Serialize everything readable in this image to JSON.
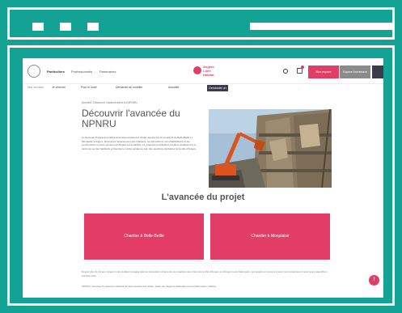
{
  "nav": {
    "links": [
      "Particuliers",
      "Professionnels",
      "Partenaires"
    ],
    "brand_line1": "Angers",
    "brand_line2": "Loire",
    "brand_line3": "Habitat",
    "btn_primary": "Mon espace",
    "btn_secondary": "Espace fournisseur"
  },
  "subnav": {
    "lead": "Nos services",
    "items": [
      "Je cherche",
      "Pour le louer",
      "Demande de mobilité",
      "Actualité"
    ],
    "button": "Demander un devis"
  },
  "breadcrumb": "Accueil / Découvrir l'avancement du NPNRU",
  "page_title": "Découvrir l'avancée du NPNRU",
  "intro_text": "Le Nouveau Programme National de Renouvellement Urbain transforme les quartiers de Belle-Beille et Monplaisir à Angers. Découvrez l'avancement des chantiers, les démolitions, les réhabilitations et les constructions neuves menées par Angers Loire Habitat. Ce programme ambitieux améliore durablement le cadre de vie des habitants et favorise la mixité sociale au sein des quartiers prioritaires de la ville d'Angers.",
  "section_title": "L'avancée du projet",
  "cards": [
    "Chantier à Belle-Beille",
    "Chantier à Monplaisir"
  ],
  "footer_texts": [
    "Depuis plus de 10 ans, Angers Loire Habitat s'engage dans la rénovation urbaine de ses quartiers aux côtés de la Ville d'Angers et d'Angers Loire Métropole. Les projets en cours et à venir sont présentés ici avec leurs calendriers prévisionnels.",
    "NPNRU: Nouveau Programme National de Renouvellement Urbain, piloté par l'Agence Nationale pour la Rénovation Urbaine."
  ],
  "fab_label": "!"
}
